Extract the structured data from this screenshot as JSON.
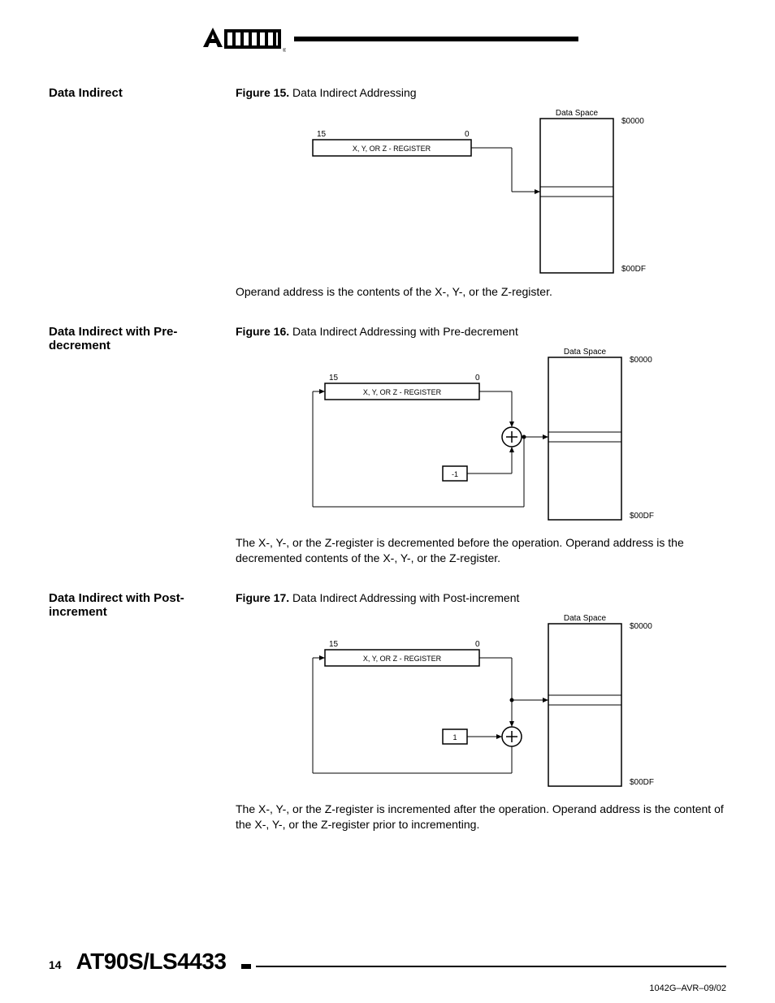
{
  "sections": [
    {
      "side_title": "Data Indirect",
      "fig_label": "Figure 15.",
      "fig_title": "Data Indirect Addressing",
      "diagram": {
        "reg_label_left": "15",
        "reg_label_right": "0",
        "reg_name": "X, Y, OR Z - REGISTER",
        "data_space_label": "Data Space",
        "addr_top": "$0000",
        "addr_bottom": "$00DF",
        "has_sum": false,
        "has_offset": false
      },
      "body": "Operand address is the contents of the X-, Y-, or the Z-register."
    },
    {
      "side_title": "Data Indirect with Pre-decrement",
      "fig_label": "Figure 16.",
      "fig_title": "Data Indirect Addressing with Pre-decrement",
      "diagram": {
        "reg_label_left": "15",
        "reg_label_right": "0",
        "reg_name": "X, Y, OR Z - REGISTER",
        "data_space_label": "Data Space",
        "addr_top": "$0000",
        "addr_bottom": "$00DF",
        "offset_value": "-1",
        "has_sum": true,
        "sum_above_offset": true,
        "return_to_reg": true
      },
      "body": "The X-, Y-, or the Z-register is decremented before the operation. Operand address is the decremented contents of the X-, Y-, or the Z-register."
    },
    {
      "side_title": "Data Indirect with Post-increment",
      "fig_label": "Figure 17.",
      "fig_title": "Data Indirect Addressing with Post-increment",
      "diagram": {
        "reg_label_left": "15",
        "reg_label_right": "0",
        "reg_name": "X, Y, OR Z - REGISTER",
        "data_space_label": "Data Space",
        "addr_top": "$0000",
        "addr_bottom": "$00DF",
        "offset_value": "1",
        "has_sum": true,
        "sum_above_offset": false,
        "return_to_reg": true
      },
      "body": "The X-, Y-, or the Z-register is incremented after the operation. Operand address is the content of the X-, Y-, or the Z-register prior to incrementing."
    }
  ],
  "footer": {
    "page": "14",
    "title": "AT90S/LS4433",
    "doc_code": "1042G–AVR–09/02"
  }
}
